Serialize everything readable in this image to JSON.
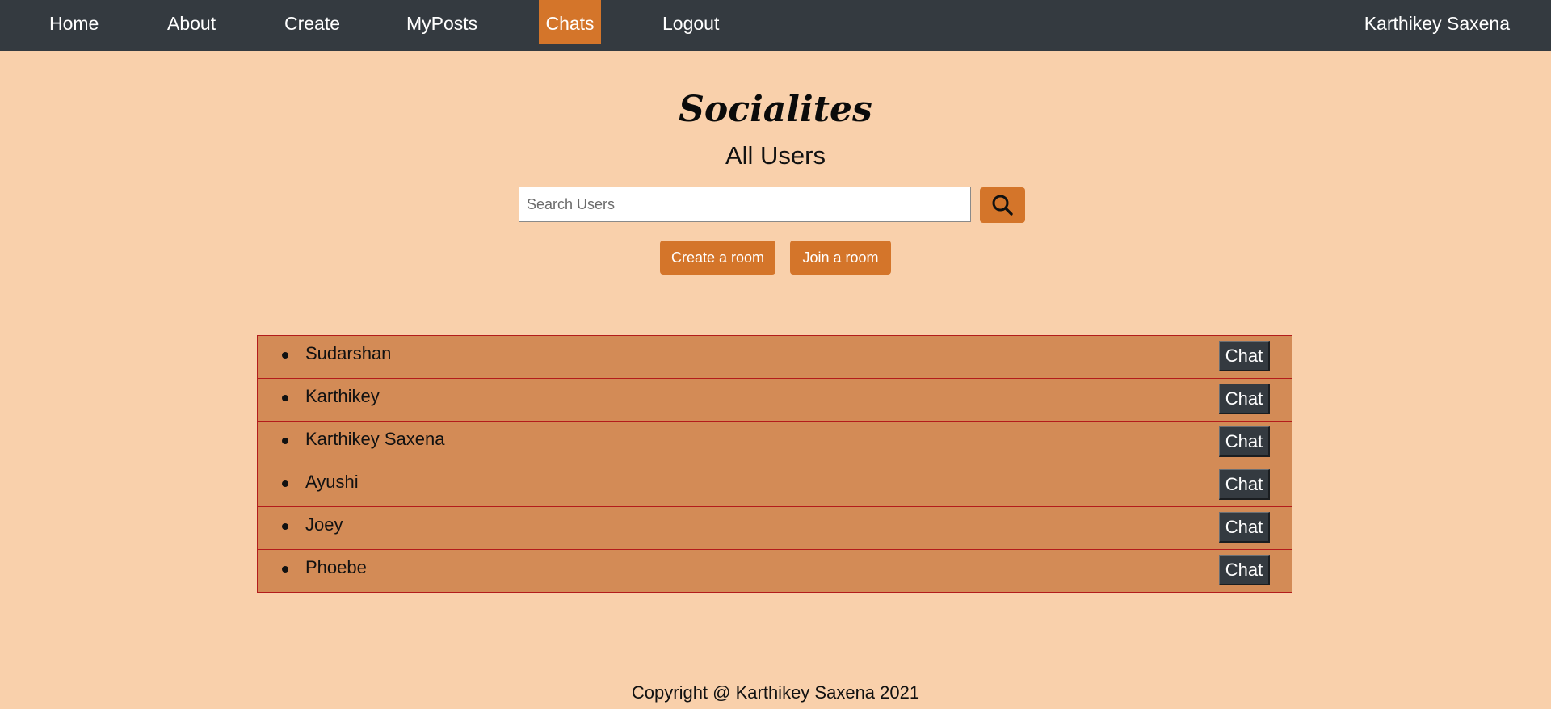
{
  "navbar": {
    "items": [
      {
        "label": "Home"
      },
      {
        "label": "About"
      },
      {
        "label": "Create"
      },
      {
        "label": "MyPosts"
      },
      {
        "label": "Chats",
        "active": true
      },
      {
        "label": "Logout"
      }
    ],
    "user": "Karthikey Saxena",
    "background": "#343a40",
    "active_color": "#d4752a"
  },
  "header": {
    "brand": "Socialites",
    "subtitle": "All Users"
  },
  "search": {
    "placeholder": "Search Users",
    "value": "",
    "icon": "search-icon"
  },
  "rooms": {
    "create_label": "Create a room",
    "join_label": "Join a room"
  },
  "users": [
    {
      "name": "Sudarshan",
      "action": "Chat"
    },
    {
      "name": "Karthikey",
      "action": "Chat"
    },
    {
      "name": "Karthikey Saxena",
      "action": "Chat"
    },
    {
      "name": "Ayushi",
      "action": "Chat"
    },
    {
      "name": "Joey",
      "action": "Chat"
    },
    {
      "name": "Phoebe",
      "action": "Chat"
    }
  ],
  "footer": {
    "copyright": "Copyright @ Karthikey Saxena 2021"
  },
  "colors": {
    "page_background": "#f9d0ab",
    "accent": "#d4752a",
    "row_background": "#d38b56",
    "row_border": "#b31b1b",
    "dark": "#343a40"
  }
}
